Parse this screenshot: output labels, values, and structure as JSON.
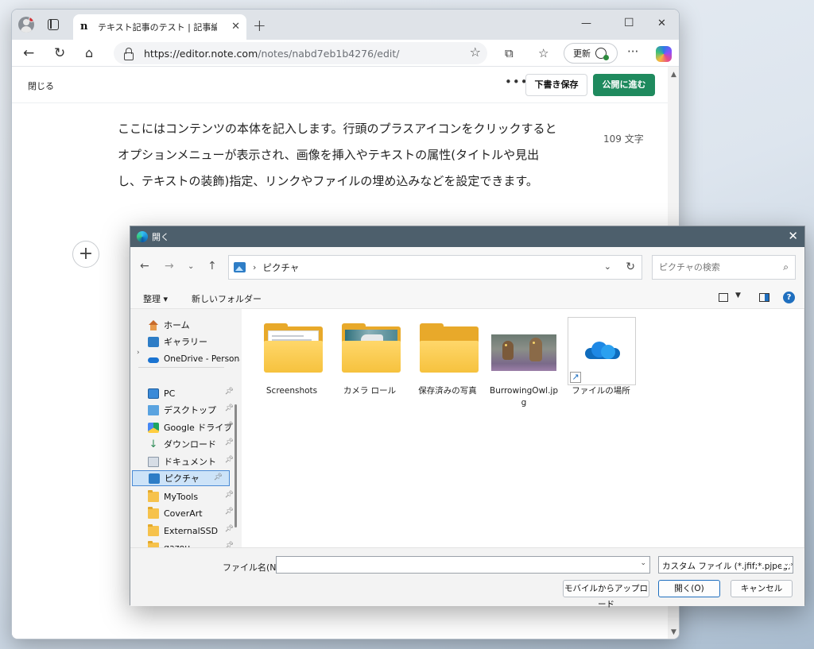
{
  "browser": {
    "tab_title": "テキスト記事のテスト | 記事編集 | note",
    "tab_favicon": "n",
    "url_host": "https://editor.note.com",
    "url_path": "/notes/nabd7eb1b4276/edit/",
    "update_label": "更新"
  },
  "note": {
    "close_label": "閉じる",
    "more_label": "•••",
    "draft_label": "下書き保存",
    "publish_label": "公開に進む",
    "body": "ここにはコンテンツの本体を記入します。行頭のプラスアイコンをクリックするとオプションメニューが表示され、画像を挿入やテキストの属性(タイトルや見出し、テキストの装飾)指定、リンクやファイルの埋め込みなどを設定できます。",
    "char_count": "109 文字",
    "plus_label": "+"
  },
  "dialog": {
    "title": "開く",
    "path_label": "ピクチャ",
    "search_placeholder": "ピクチャの検索",
    "organize_label": "整理 ▾",
    "new_folder_label": "新しいフォルダー",
    "help_label": "?",
    "sidebar": [
      {
        "label": "ホーム"
      },
      {
        "label": "ギャラリー"
      },
      {
        "label": "OneDrive - Personal"
      },
      {
        "label": "PC"
      },
      {
        "label": "デスクトップ"
      },
      {
        "label": "Google ドライブ"
      },
      {
        "label": "ダウンロード"
      },
      {
        "label": "ドキュメント"
      },
      {
        "label": "ピクチャ"
      },
      {
        "label": "MyTools"
      },
      {
        "label": "CoverArt"
      },
      {
        "label": "ExternalSSD"
      },
      {
        "label": "gazou"
      }
    ],
    "files": [
      {
        "name": "Screenshots"
      },
      {
        "name": "カメラ ロール"
      },
      {
        "name": "保存済みの写真"
      },
      {
        "name": "BurrowingOwl.jpg"
      },
      {
        "name": "ファイルの場所"
      }
    ],
    "filename_label": "ファイル名(N):",
    "filename_value": "",
    "filetype_value": "カスタム ファイル (*.jfif;*.pjpeg;*.jpg;*.jpeg)",
    "mobile_upload_label": "モバイルからアップロード",
    "open_label": "開く(O)",
    "cancel_label": "キャンセル"
  },
  "colors": {
    "publish_green": "#1f8a5e",
    "dialog_title_bg": "#4d5f6c",
    "selection_bg": "#cde3f8",
    "folder_yellow": "#f6c23e"
  }
}
